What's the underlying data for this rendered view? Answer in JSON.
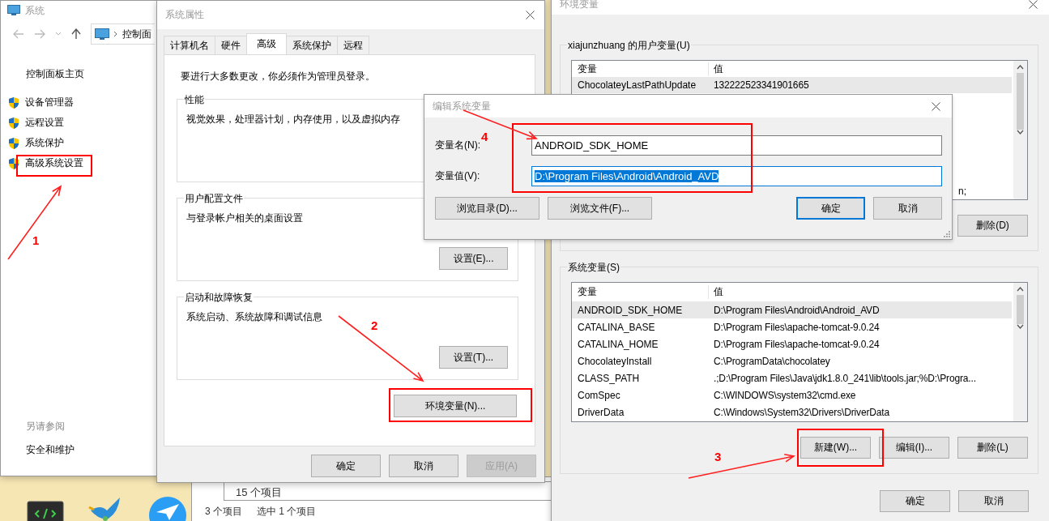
{
  "system_window": {
    "title": "系统",
    "address": "控制面",
    "home_link": "控制面板主页",
    "nav_items": [
      "设备管理器",
      "远程设置",
      "系统保护",
      "高级系统设置"
    ],
    "see_also_heading": "另请参阅",
    "see_also_links": [
      "安全和维护"
    ]
  },
  "explorer_back": {
    "item_count": "3 个项目",
    "selection": "选中 1 个项目"
  },
  "explorer_front": {
    "item_count": "15 个项目"
  },
  "system_properties": {
    "title": "系统属性",
    "tabs": [
      {
        "label": "计算机名",
        "selected": false
      },
      {
        "label": "硬件",
        "selected": false
      },
      {
        "label": "高级",
        "selected": true
      },
      {
        "label": "系统保护",
        "selected": false
      },
      {
        "label": "远程",
        "selected": false
      }
    ],
    "admin_notice": "要进行大多数更改，你必须作为管理员登录。",
    "groups": [
      {
        "title": "性能",
        "description": "视觉效果，处理器计划，内存使用，以及虚拟内存"
      },
      {
        "title": "用户配置文件",
        "description": "与登录帐户相关的桌面设置",
        "button": "设置(E)..."
      },
      {
        "title": "启动和故障恢复",
        "description": "系统启动、系统故障和调试信息",
        "button": "设置(T)..."
      }
    ],
    "env_button": "环境变量(N)...",
    "footer_buttons": [
      {
        "label": "确定",
        "disabled": false
      },
      {
        "label": "取消",
        "disabled": false
      },
      {
        "label": "应用(A)",
        "disabled": true
      }
    ]
  },
  "environment_variables": {
    "title": "环境变量",
    "user_vars": {
      "title": "xiajunzhuang 的用户变量(U)",
      "columns": [
        "变量",
        "值"
      ],
      "rows": [
        {
          "name": "ChocolateyLastPathUpdate",
          "value": "132222523341901665",
          "selected": true
        }
      ],
      "tail_text": "n;",
      "buttons": [
        "删除(D)"
      ]
    },
    "system_vars": {
      "title": "系统变量(S)",
      "columns": [
        "变量",
        "值"
      ],
      "rows": [
        {
          "name": "ANDROID_SDK_HOME",
          "value": "D:\\Program Files\\Android\\Android_AVD",
          "selected": true
        },
        {
          "name": "CATALINA_BASE",
          "value": "D:\\Program Files\\apache-tomcat-9.0.24",
          "selected": false
        },
        {
          "name": "CATALINA_HOME",
          "value": "D:\\Program Files\\apache-tomcat-9.0.24",
          "selected": false
        },
        {
          "name": "ChocolateyInstall",
          "value": "C:\\ProgramData\\chocolatey",
          "selected": false
        },
        {
          "name": "CLASS_PATH",
          "value": ".;D:\\Program Files\\Java\\jdk1.8.0_241\\lib\\tools.jar;%D:\\Progra...",
          "selected": false
        },
        {
          "name": "ComSpec",
          "value": "C:\\WINDOWS\\system32\\cmd.exe",
          "selected": false
        },
        {
          "name": "DriverData",
          "value": "C:\\Windows\\System32\\Drivers\\DriverData",
          "selected": false
        }
      ],
      "buttons": [
        "新建(W)...",
        "编辑(I)...",
        "删除(L)"
      ]
    },
    "footer_buttons": [
      "确定",
      "取消"
    ]
  },
  "edit_dialog": {
    "title": "编辑系统变量",
    "fields": [
      {
        "label": "变量名(N):",
        "value": "ANDROID_SDK_HOME",
        "selected": false
      },
      {
        "label": "变量值(V):",
        "value": "D:\\Program Files\\Android\\Android_AVD",
        "selected": true
      }
    ],
    "left_buttons": [
      "浏览目录(D)...",
      "浏览文件(F)..."
    ],
    "right_buttons": [
      {
        "label": "确定",
        "default": true
      },
      {
        "label": "取消",
        "default": false
      }
    ]
  },
  "annotations": [
    {
      "number": "1"
    },
    {
      "number": "2"
    },
    {
      "number": "3"
    },
    {
      "number": "4"
    }
  ]
}
